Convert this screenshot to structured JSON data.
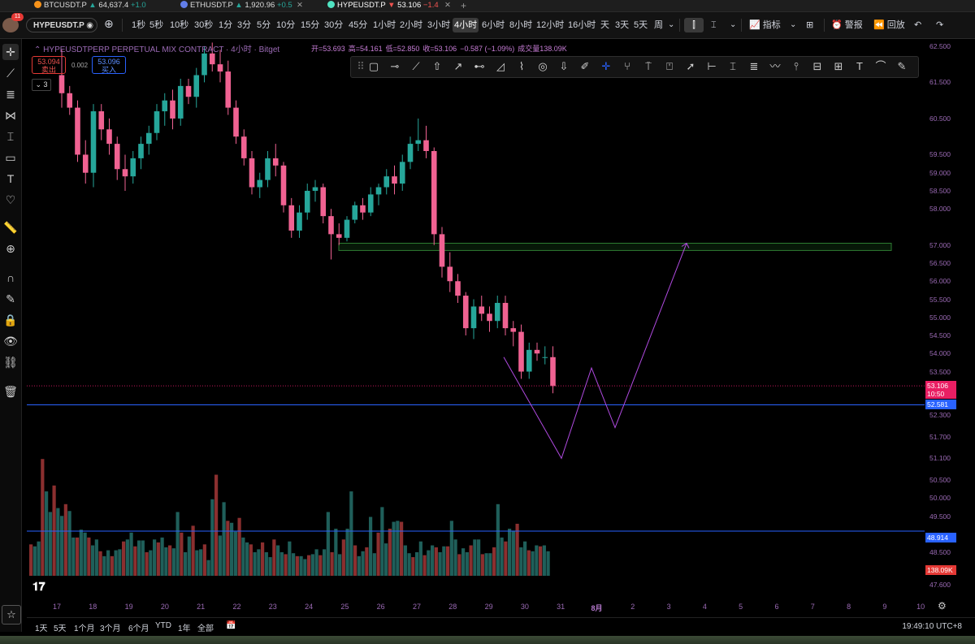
{
  "tabs": [
    {
      "symbol": "BTCUSDT.P",
      "dir": "▲",
      "price": "64,637.4",
      "change": "+1.0",
      "dot": "#f7931a",
      "dir_class": "up"
    },
    {
      "symbol": "ETHUSDT.P",
      "dir": "▲",
      "price": "1,920.96",
      "change": "+0.5",
      "dot": "#627eea",
      "dir_class": "up"
    },
    {
      "symbol": "HYPEUSDT.P",
      "dir": "▼",
      "price": "53.106",
      "change": "−1.4",
      "dot": "#50e3c2",
      "dir_class": "dn"
    }
  ],
  "avatar_badge": "11",
  "symbol_box": "HYPEUSDT.P",
  "intervals": [
    "1秒",
    "5秒",
    "10秒",
    "30秒",
    "1分",
    "3分",
    "5分",
    "10分",
    "15分",
    "30分",
    "45分",
    "1小时",
    "2小时",
    "3小时",
    "4小时",
    "6小时",
    "8小时",
    "12小时",
    "16小时",
    "天",
    "3天",
    "5天",
    "周"
  ],
  "selected_interval": "4小时",
  "toolbar": {
    "indicators": "指标",
    "alerts": "警报",
    "replay": "回放"
  },
  "legend": {
    "title": "HYPEUSDTPERP PERPETUAL MIX CONTRACT · 4小时 · Bitget"
  },
  "ohlc": {
    "open": "开=53.693",
    "high": "高=54.161",
    "low": "低=52.850",
    "close": "收=53.106",
    "change": "−0.587 (−1.09%)",
    "volume": "成交量138.09K"
  },
  "trade": {
    "sell_price": "53.094",
    "sell_label": "卖出",
    "spread": "0.002",
    "buy_price": "53.096",
    "buy_label": "买入"
  },
  "collapse_count": "3",
  "price_axis": [
    "62.500",
    "61.500",
    "60.500",
    "59.500",
    "59.000",
    "58.500",
    "58.000",
    "57.000",
    "56.500",
    "56.000",
    "55.500",
    "55.000",
    "54.500",
    "54.000",
    "53.500",
    "52.300",
    "51.700",
    "51.100",
    "50.500",
    "50.000",
    "49.500",
    "48.500",
    "47.600"
  ],
  "price_tags": {
    "last": "53.106",
    "countdown": "10:50",
    "blue_line": "52.581",
    "volume_line": "48.914",
    "volume": "138.09K"
  },
  "time_axis": [
    "17",
    "18",
    "19",
    "20",
    "21",
    "22",
    "23",
    "24",
    "25",
    "26",
    "27",
    "28",
    "29",
    "30",
    "31",
    "8月",
    "2",
    "3",
    "4",
    "5",
    "6",
    "7",
    "8",
    "9",
    "10"
  ],
  "ranges": [
    "1天",
    "5天",
    "1个月",
    "3个月",
    "6个月",
    "YTD",
    "1年",
    "全部"
  ],
  "clock": "19:49:10 UTC+8",
  "colors": {
    "up": "#26a69a",
    "down": "#f06292",
    "draw": "#b04ae0",
    "zone": "#1b5e20",
    "hline": "#2962ff"
  },
  "chart_data": {
    "type": "candlestick",
    "title": "HYPEUSDTPERP PERPETUAL MIX CONTRACT · 4小时 · Bitget",
    "ylim": [
      47.2,
      62.7
    ],
    "candles": [
      [
        61.7,
        62.4,
        60.8,
        61.2
      ],
      [
        61.2,
        61.4,
        60.6,
        60.8
      ],
      [
        60.8,
        61.0,
        59.3,
        59.5
      ],
      [
        59.5,
        59.9,
        58.7,
        59.0
      ],
      [
        59.0,
        60.9,
        58.6,
        60.7
      ],
      [
        60.7,
        60.9,
        59.9,
        60.2
      ],
      [
        60.2,
        60.5,
        59.5,
        59.8
      ],
      [
        59.8,
        60.0,
        58.8,
        59.1
      ],
      [
        59.1,
        59.5,
        58.5,
        58.9
      ],
      [
        58.9,
        59.6,
        58.7,
        59.4
      ],
      [
        59.4,
        60.0,
        59.1,
        59.8
      ],
      [
        59.8,
        60.3,
        59.5,
        60.1
      ],
      [
        60.1,
        60.9,
        59.9,
        60.7
      ],
      [
        60.7,
        61.2,
        60.3,
        61.0
      ],
      [
        61.0,
        61.3,
        60.2,
        60.5
      ],
      [
        60.5,
        61.6,
        60.3,
        61.4
      ],
      [
        61.4,
        61.6,
        60.9,
        61.1
      ],
      [
        61.1,
        61.9,
        60.8,
        61.7
      ],
      [
        61.7,
        62.5,
        61.5,
        62.3
      ],
      [
        62.3,
        62.6,
        61.8,
        62.0
      ],
      [
        62.0,
        62.4,
        61.5,
        61.8
      ],
      [
        61.8,
        62.1,
        60.6,
        60.8
      ],
      [
        60.8,
        61.0,
        59.8,
        60.0
      ],
      [
        60.0,
        60.2,
        59.2,
        59.4
      ],
      [
        59.4,
        59.6,
        58.4,
        58.6
      ],
      [
        58.6,
        59.0,
        58.3,
        58.8
      ],
      [
        58.8,
        59.6,
        58.6,
        59.4
      ],
      [
        59.4,
        59.8,
        58.9,
        59.2
      ],
      [
        59.2,
        59.3,
        57.9,
        58.1
      ],
      [
        58.1,
        58.3,
        57.2,
        57.4
      ],
      [
        57.4,
        58.1,
        57.2,
        57.9
      ],
      [
        57.9,
        58.7,
        57.7,
        58.5
      ],
      [
        58.5,
        58.8,
        58.2,
        58.6
      ],
      [
        58.6,
        58.7,
        57.6,
        57.8
      ],
      [
        57.8,
        58.0,
        56.6,
        57.3
      ],
      [
        57.3,
        57.6,
        57.0,
        57.2
      ],
      [
        57.2,
        57.8,
        57.1,
        57.7
      ],
      [
        57.7,
        58.2,
        57.6,
        58.1
      ],
      [
        58.1,
        58.3,
        57.7,
        57.9
      ],
      [
        57.9,
        58.6,
        57.8,
        58.4
      ],
      [
        58.4,
        58.7,
        58.1,
        58.6
      ],
      [
        58.6,
        59.1,
        58.4,
        58.9
      ],
      [
        58.9,
        59.2,
        58.4,
        58.7
      ],
      [
        58.7,
        59.5,
        58.5,
        59.3
      ],
      [
        59.3,
        60.0,
        59.1,
        59.8
      ],
      [
        59.8,
        60.5,
        59.6,
        59.9
      ],
      [
        59.9,
        60.3,
        59.4,
        59.6
      ],
      [
        59.6,
        59.7,
        57.0,
        57.3
      ],
      [
        57.3,
        57.5,
        56.1,
        56.4
      ],
      [
        56.4,
        56.8,
        55.7,
        56.0
      ],
      [
        56.0,
        56.2,
        55.4,
        55.6
      ],
      [
        55.6,
        55.7,
        54.5,
        54.7
      ],
      [
        54.7,
        55.5,
        54.4,
        55.3
      ],
      [
        55.3,
        55.6,
        54.9,
        55.1
      ],
      [
        55.1,
        55.3,
        54.6,
        54.9
      ],
      [
        54.9,
        55.6,
        54.7,
        55.4
      ],
      [
        55.4,
        55.6,
        54.5,
        54.7
      ],
      [
        54.7,
        54.9,
        54.2,
        54.6
      ],
      [
        54.6,
        54.8,
        53.3,
        53.5
      ],
      [
        53.5,
        54.3,
        53.3,
        54.1
      ],
      [
        54.1,
        54.3,
        53.8,
        54.0
      ],
      [
        53.9,
        54.2,
        53.7,
        53.9
      ],
      [
        53.9,
        54.2,
        52.9,
        53.1
      ]
    ],
    "volume": [
      3.2,
      3.0,
      3.5,
      11.9,
      8.6,
      6.5,
      9.2,
      6.9,
      6.1,
      7.3,
      6.6,
      3.9,
      3.9,
      4.7,
      4.4,
      3.9,
      3.1,
      3.7,
      2.5,
      2.0,
      2.6,
      2.0,
      2.6,
      2.7,
      3.5,
      3.7,
      4.4,
      3.0,
      3.6,
      3.6,
      2.4,
      2.6,
      3.7,
      3.4,
      3.9,
      2.9,
      3.1,
      2.8,
      6.5,
      4.4,
      2.4,
      4.0,
      5.1,
      2.6,
      2.7,
      3.2,
      1.6,
      7.8,
      10.3,
      4.1,
      7.5,
      5.6,
      5.4,
      4.5,
      5.9,
      3.9,
      3.4,
      3.2,
      2.4,
      2.7,
      3.4,
      2.4,
      1.9,
      3.7,
      3.1,
      2.4,
      2.2,
      3.5,
      2.3,
      2.0,
      2.0,
      1.7,
      2.1,
      2.2,
      2.7,
      2.1,
      2.7,
      6.5,
      2.4,
      4.8,
      2.2,
      3.7,
      4.8,
      8.6,
      3.1,
      2.0,
      2.5,
      2.9,
      6.0,
      2.3,
      4.4,
      7.0,
      3.3,
      4.8,
      5.5,
      5.6,
      5.5,
      3.1,
      2.3,
      1.9,
      2.4,
      3.5,
      2.1,
      2.6,
      3.1,
      2.9,
      2.4,
      3.0,
      3.0,
      5.6,
      3.7,
      2.2,
      2.8,
      2.4,
      3.1,
      3.7,
      3.7,
      2.2,
      2.3,
      2.3,
      2.9,
      7.3,
      3.9,
      3.5,
      4.8,
      4.6,
      5.3,
      2.9,
      3.5,
      2.6,
      2.5,
      3.1,
      3.0,
      3.1,
      2.5
    ],
    "zone": [
      57.05,
      56.85
    ],
    "hline_price": 52.581,
    "hline_volume": 48.914,
    "last_price": 53.106,
    "projection_path": [
      [
        53.9,
        0
      ],
      [
        51.1,
        1
      ],
      [
        53.6,
        2
      ],
      [
        51.95,
        3
      ],
      [
        57.05,
        4
      ]
    ]
  }
}
